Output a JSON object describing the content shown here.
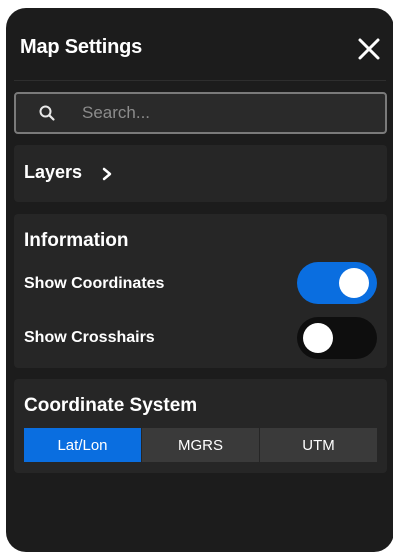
{
  "header": {
    "title": "Map Settings",
    "close_icon": "close-icon"
  },
  "search": {
    "placeholder": "Search...",
    "value": "",
    "icon": "search-icon"
  },
  "layers": {
    "label": "Layers",
    "icon": "chevron-right-icon"
  },
  "information": {
    "title": "Information",
    "rows": [
      {
        "label": "Show Coordinates",
        "enabled": true
      },
      {
        "label": "Show Crosshairs",
        "enabled": false
      }
    ]
  },
  "coordinate_system": {
    "title": "Coordinate System",
    "options": [
      "Lat/Lon",
      "MGRS",
      "UTM"
    ],
    "selected": "Lat/Lon"
  },
  "colors": {
    "panel_bg": "#1c1c1c",
    "card_bg": "#262626",
    "accent": "#0a6ee0",
    "toggle_off": "#0e0e0e"
  }
}
